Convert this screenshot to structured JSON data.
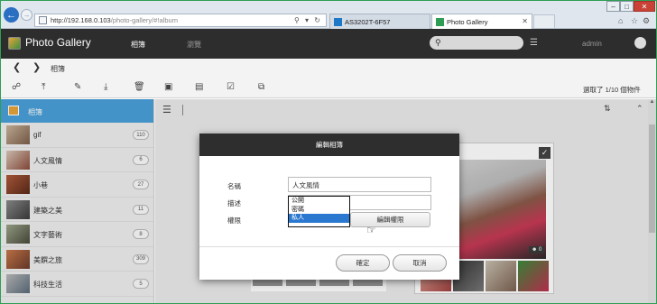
{
  "browser": {
    "url": "http://192.168.0.103",
    "url_path": "/photo-gallery/#!album",
    "tabs": [
      {
        "label": "AS3202T-6F57"
      },
      {
        "label": "Photo Gallery"
      }
    ]
  },
  "app": {
    "title": "Photo Gallery",
    "nav": {
      "albums": "相簿",
      "browse": "瀏覽"
    },
    "user": "admin"
  },
  "breadcrumb": {
    "current": "相簿"
  },
  "toolbar": {
    "selection_status": "選取了 1/10 個物件"
  },
  "sidebar": {
    "header": "相簿",
    "albums": [
      {
        "name": "gif",
        "count": "110"
      },
      {
        "name": "人文風情",
        "count": "6"
      },
      {
        "name": "小巷",
        "count": "27"
      },
      {
        "name": "建築之美",
        "count": "11"
      },
      {
        "name": "文字藝術",
        "count": "8"
      },
      {
        "name": "美饌之旅",
        "count": "309"
      },
      {
        "name": "科技生活",
        "count": "5"
      }
    ]
  },
  "card": {
    "people_count": "0"
  },
  "dialog": {
    "title": "編輯相簿",
    "labels": {
      "name": "名稱",
      "description": "描述",
      "permission": "權限"
    },
    "name_value": "人文風情",
    "permission_options": [
      "公開",
      "密碼",
      "私人"
    ],
    "permission_selected": "私人",
    "edit_permission_button": "編輯權限",
    "ok_button": "確定",
    "cancel_button": "取消"
  },
  "colors": {
    "accent": "#4aa0d9",
    "header_bg": "#2d2d2d",
    "selected_option": "#2b78d0"
  }
}
